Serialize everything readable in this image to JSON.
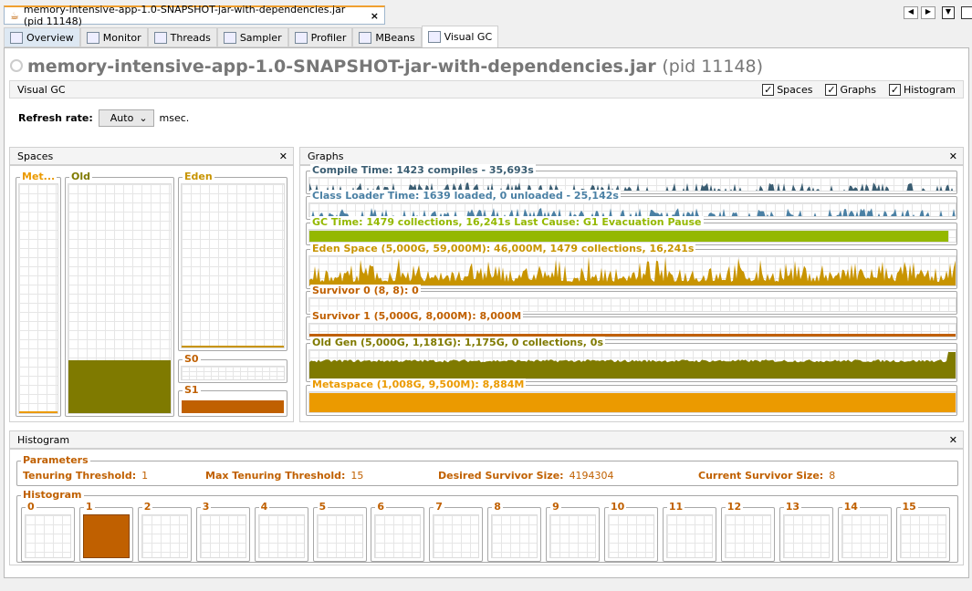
{
  "window": {
    "doc_tab": "memory-intensive-app-1.0-SNAPSHOT-jar-with-dependencies.jar (pid 11148)"
  },
  "tabs": [
    {
      "label": "Overview",
      "icon": "overview-icon"
    },
    {
      "label": "Monitor",
      "icon": "monitor-icon"
    },
    {
      "label": "Threads",
      "icon": "threads-icon"
    },
    {
      "label": "Sampler",
      "icon": "sampler-icon"
    },
    {
      "label": "Profiler",
      "icon": "profiler-icon"
    },
    {
      "label": "MBeans",
      "icon": "mbeans-icon"
    },
    {
      "label": "Visual GC",
      "icon": "visualgc-icon",
      "selected": true
    }
  ],
  "header": {
    "app": "memory-intensive-app-1.0-SNAPSHOT-jar-with-dependencies.jar",
    "pid": "(pid 11148)"
  },
  "visualgc": {
    "label": "Visual GC",
    "checks": [
      {
        "label": "Spaces",
        "checked": true
      },
      {
        "label": "Graphs",
        "checked": true
      },
      {
        "label": "Histogram",
        "checked": true
      }
    ]
  },
  "refresh": {
    "label": "Refresh rate:",
    "value": "Auto",
    "unit": "msec."
  },
  "spaces": {
    "title": "Spaces",
    "meta": "Met...",
    "old": "Old",
    "eden": "Eden",
    "s0": "S0",
    "s1": "S1",
    "old_fill": 0.22,
    "s1_fill": 0.5,
    "meta_fill": 0.01,
    "eden_fill": 0.01
  },
  "graphs": {
    "title": "Graphs",
    "rows": [
      {
        "label": "Compile Time: 1423 compiles - 35,693s",
        "color": "#3a5d72",
        "type": "spikes"
      },
      {
        "label": "Class Loader Time: 1639 loaded, 0 unloaded - 25,142s",
        "color": "#4a80a4",
        "type": "spikes"
      },
      {
        "label": "GC Time: 1479 collections, 16,241s  Last Cause: G1 Evacuation Pause",
        "color": "#94b800",
        "type": "full"
      },
      {
        "label": "Eden Space (5,000G, 59,000M): 46,000M, 1479 collections, 16,241s",
        "color": "#c89400",
        "type": "noise"
      },
      {
        "label": "Survivor 0 (8, 8): 0",
        "color": "#c06000",
        "type": "empty"
      },
      {
        "label": "Survivor 1 (5,000G, 8,000M): 8,000M",
        "color": "#c06000",
        "type": "full"
      },
      {
        "label": "Old Gen (5,000G, 1,181G): 1,175G, 0 collections, 0s",
        "color": "#7f7a00",
        "type": "high"
      },
      {
        "label": "Metaspace (1,008G, 9,500M): 8,884M",
        "color": "#eb9a00",
        "type": "full"
      }
    ]
  },
  "colors": {
    "meta": "#eb9a00",
    "old": "#7f7a00",
    "eden": "#c89400",
    "survivor": "#c06000"
  },
  "histogram": {
    "title": "Histogram",
    "params_title": "Parameters",
    "params": [
      {
        "label": "Tenuring Threshold:",
        "value": "1"
      },
      {
        "label": "Max Tenuring Threshold:",
        "value": "15"
      },
      {
        "label": "Desired Survivor Size:",
        "value": "4194304"
      },
      {
        "label": "Current Survivor Size:",
        "value": "8"
      }
    ],
    "hist_title": "Histogram",
    "bins": [
      "0",
      "1",
      "2",
      "3",
      "4",
      "5",
      "6",
      "7",
      "8",
      "9",
      "10",
      "11",
      "12",
      "13",
      "14",
      "15"
    ],
    "filled_bin": 1
  }
}
